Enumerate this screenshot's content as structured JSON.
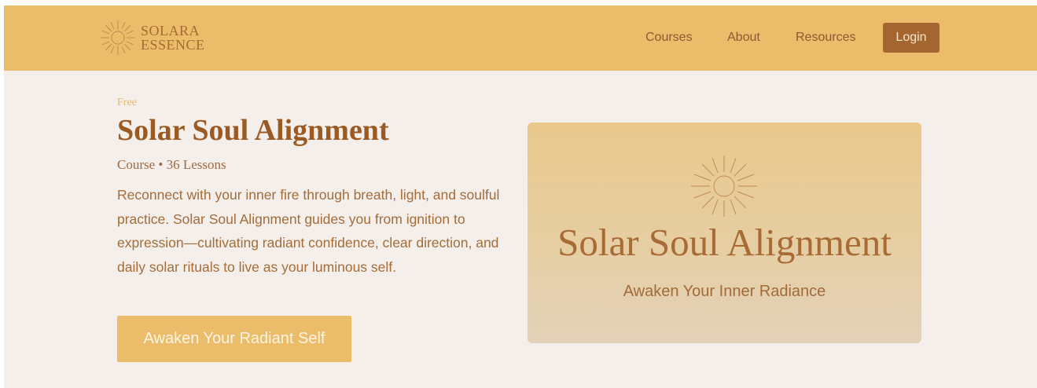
{
  "brand": {
    "line1": "SOLARA",
    "line2": "ESSENCE",
    "icon": "sun-icon",
    "color": "#a66a33"
  },
  "nav": {
    "items": [
      {
        "label": "Courses"
      },
      {
        "label": "About"
      },
      {
        "label": "Resources"
      }
    ],
    "login_label": "Login"
  },
  "course": {
    "badge": "Free",
    "title": "Solar Soul Alignment",
    "meta": "Course • 36 Lessons",
    "description": "Reconnect with your inner fire through breath, light, and soulful practice. Solar Soul Alignment guides you from ignition to expression—cultivating radiant confidence, clear direction, and daily solar rituals to live as your luminous self.",
    "cta_label": "Awaken Your Radiant Self"
  },
  "hero": {
    "title": "Solar Soul Alignment",
    "subtitle": "Awaken Your Inner Radiance",
    "icon": "sun-icon"
  },
  "colors": {
    "header_bg": "#ebbd6b",
    "page_bg": "#f5efeb",
    "accent_brown": "#a5652f",
    "title_brown": "#9b5a23"
  }
}
